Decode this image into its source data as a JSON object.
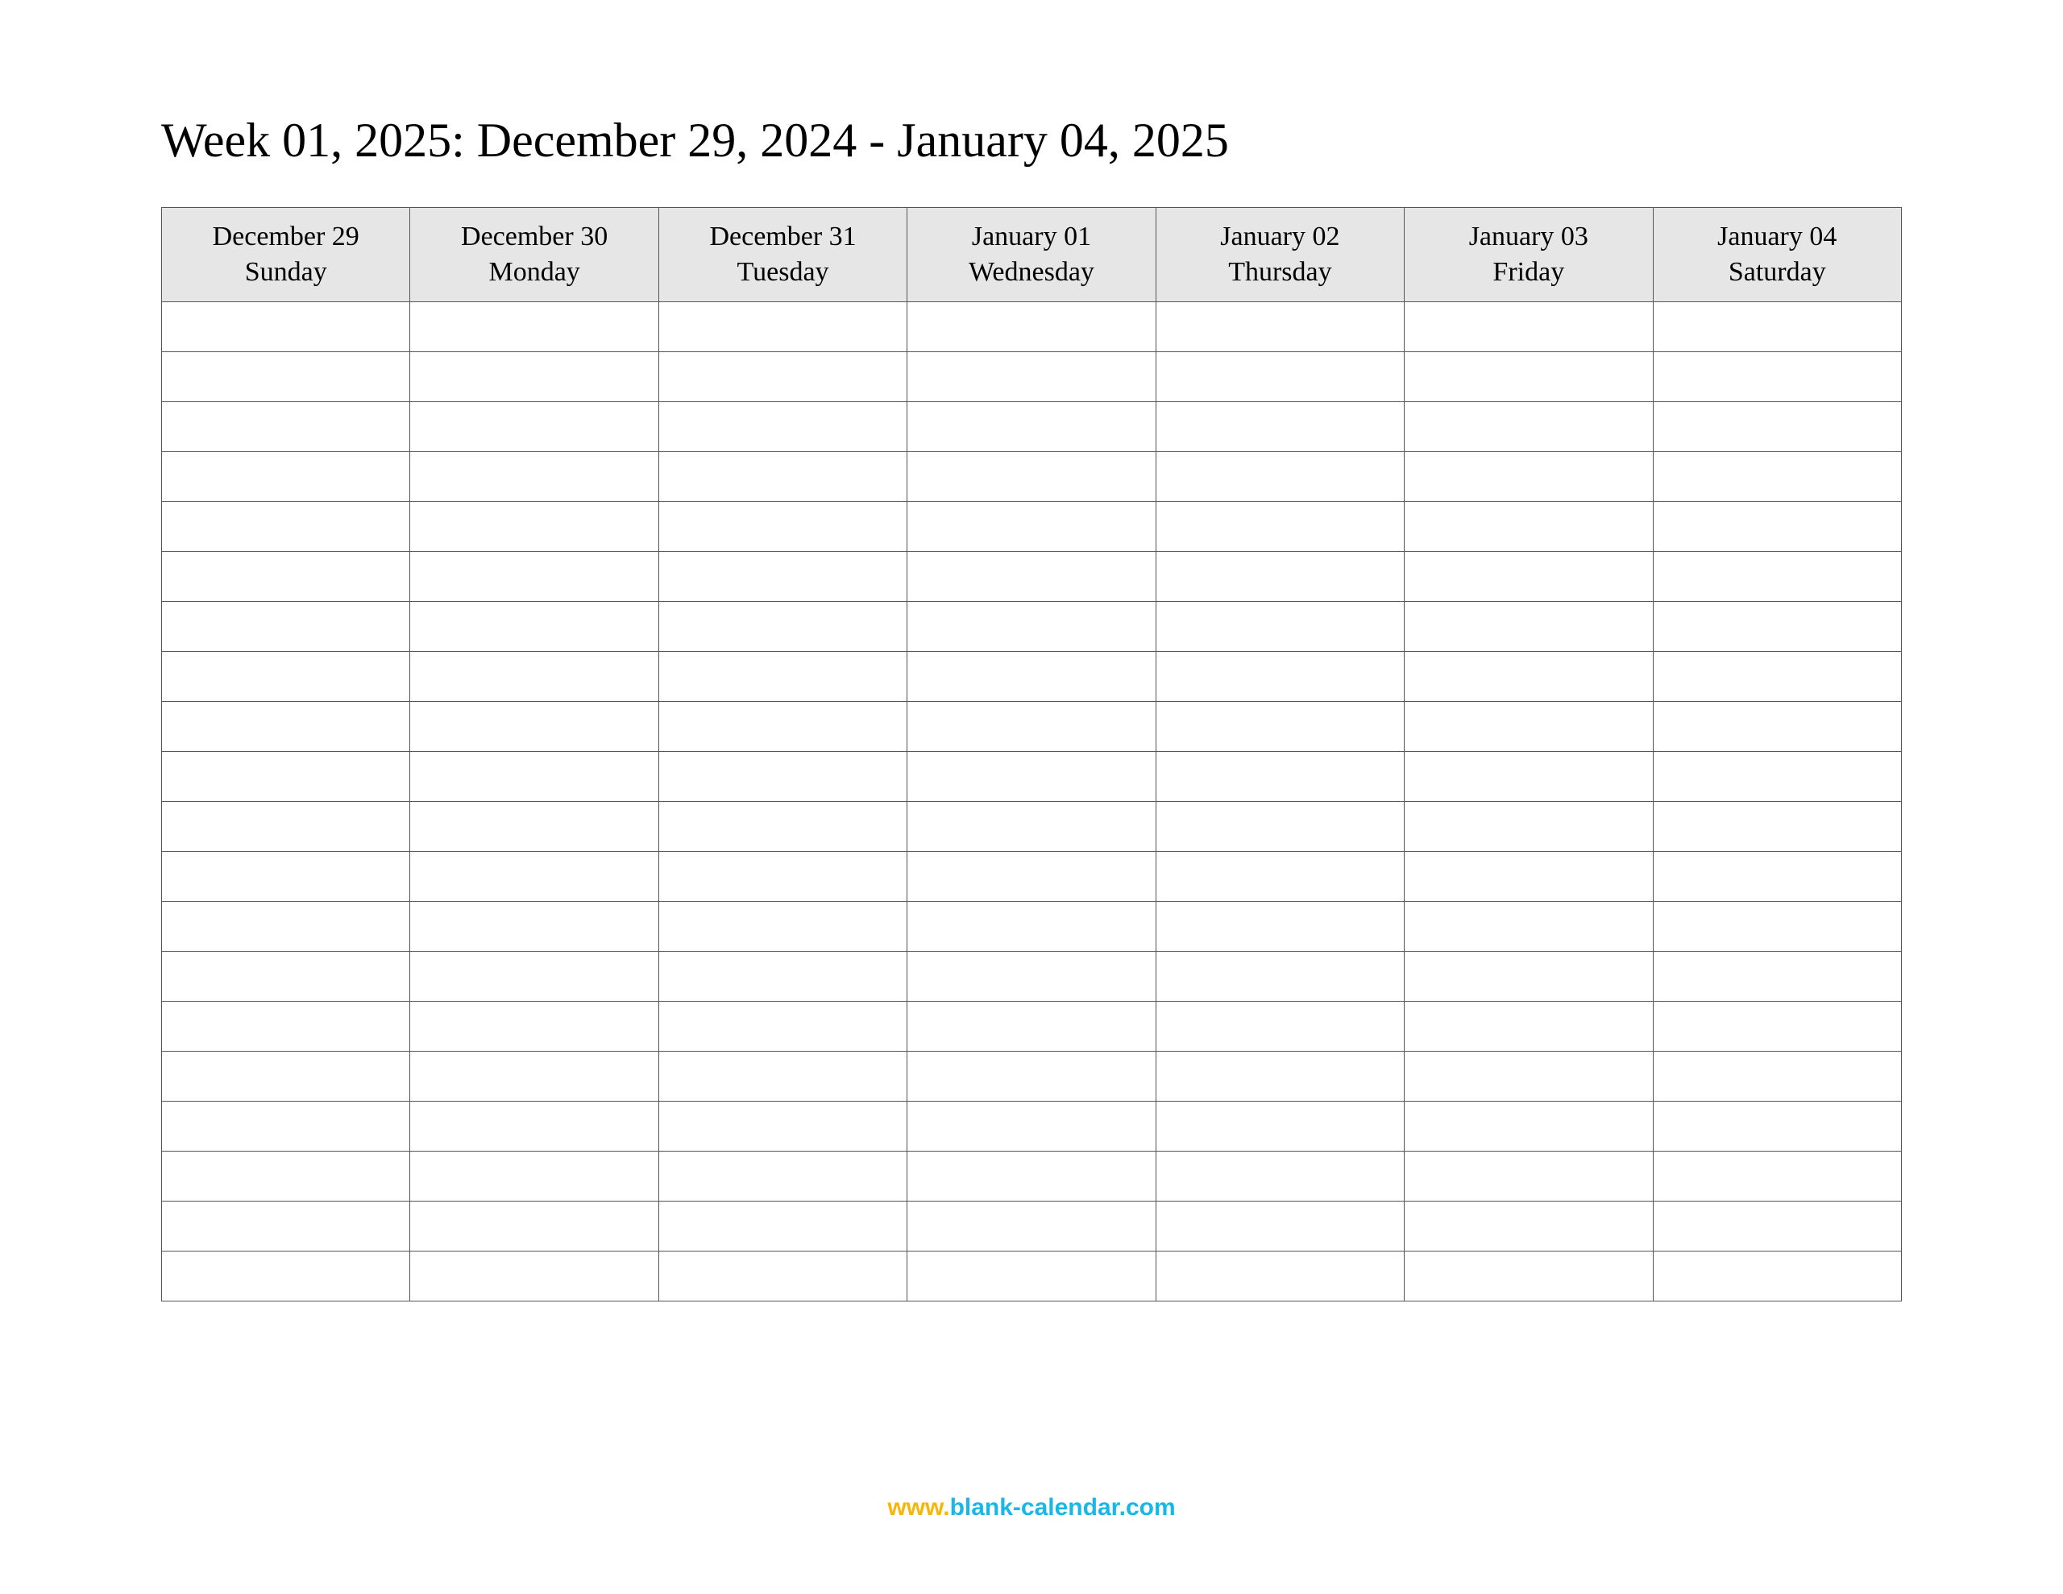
{
  "title": "Week 01, 2025: December 29, 2024 - January 04, 2025",
  "columns": [
    {
      "date": "December 29",
      "day": "Sunday"
    },
    {
      "date": "December 30",
      "day": "Monday"
    },
    {
      "date": "December 31",
      "day": "Tuesday"
    },
    {
      "date": "January 01",
      "day": "Wednesday"
    },
    {
      "date": "January 02",
      "day": "Thursday"
    },
    {
      "date": "January 03",
      "day": "Friday"
    },
    {
      "date": "January 04",
      "day": "Saturday"
    }
  ],
  "rows": 20,
  "footer": {
    "www": "www.",
    "domain": "blank-calendar.com"
  }
}
